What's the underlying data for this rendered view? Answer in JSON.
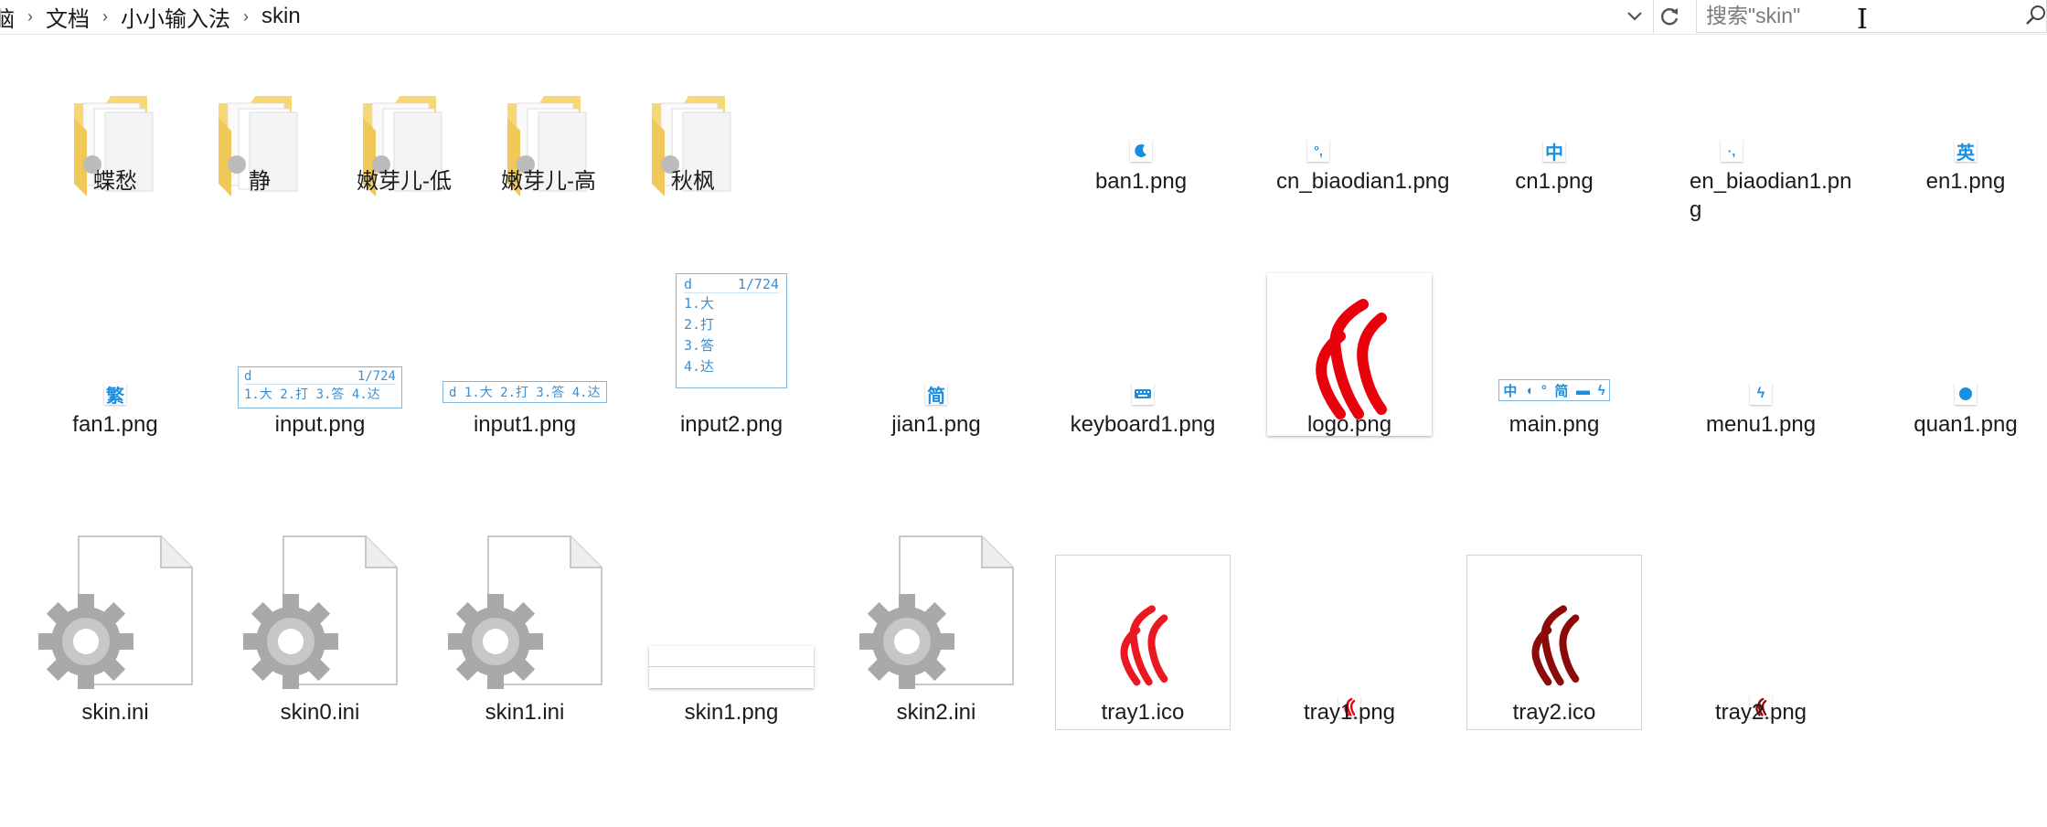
{
  "breadcrumb": [
    "脑",
    "文档",
    "小小输入法",
    "skin"
  ],
  "search": {
    "placeholder": "搜索\"skin\""
  },
  "colors": {
    "accent": "#1a8fe0",
    "folder": "#f7d874",
    "logo_red": "#e8000a",
    "tray2_red": "#8b0b0b"
  },
  "items": [
    {
      "name": "蝶愁",
      "type": "folder"
    },
    {
      "name": "静",
      "type": "folder"
    },
    {
      "name": "嫩芽儿-低",
      "type": "folder"
    },
    {
      "name": "嫩芽儿-高",
      "type": "folder"
    },
    {
      "name": "秋枫",
      "type": "folder"
    },
    {
      "name": "ban1.png",
      "type": "png"
    },
    {
      "name": "cn_biaodian1.png",
      "type": "png"
    },
    {
      "name": "cn1.png",
      "type": "png",
      "glyph": "中"
    },
    {
      "name": "en_biaodian1.png",
      "type": "png"
    },
    {
      "name": "en1.png",
      "type": "png",
      "glyph": "英"
    },
    {
      "name": "fan1.png",
      "type": "png",
      "glyph": "繁"
    },
    {
      "name": "input.png",
      "type": "png"
    },
    {
      "name": "input1.png",
      "type": "png"
    },
    {
      "name": "input2.png",
      "type": "png"
    },
    {
      "name": "jian1.png",
      "type": "png",
      "glyph": "简"
    },
    {
      "name": "keyboard1.png",
      "type": "png"
    },
    {
      "name": "logo.png",
      "type": "png"
    },
    {
      "name": "main.png",
      "type": "png"
    },
    {
      "name": "menu1.png",
      "type": "png"
    },
    {
      "name": "quan1.png",
      "type": "png"
    },
    {
      "name": "skin.ini",
      "type": "ini"
    },
    {
      "name": "skin0.ini",
      "type": "ini"
    },
    {
      "name": "skin1.ini",
      "type": "ini"
    },
    {
      "name": "skin1.png",
      "type": "png"
    },
    {
      "name": "skin2.ini",
      "type": "ini"
    },
    {
      "name": "tray1.ico",
      "type": "ico"
    },
    {
      "name": "tray1.png",
      "type": "png"
    },
    {
      "name": "tray2.ico",
      "type": "ico"
    },
    {
      "name": "tray2.png",
      "type": "png"
    }
  ],
  "thumbs": {
    "input": {
      "code": "d",
      "count": "1/724",
      "candidates": "1.大 2.打 3.答 4.达"
    },
    "input2": {
      "code": "d",
      "count": "1/724",
      "candidates": [
        "1.大",
        "2.打",
        "3.答",
        "4.达"
      ]
    },
    "main": {
      "glyphs": "中",
      "jian": "简"
    }
  }
}
